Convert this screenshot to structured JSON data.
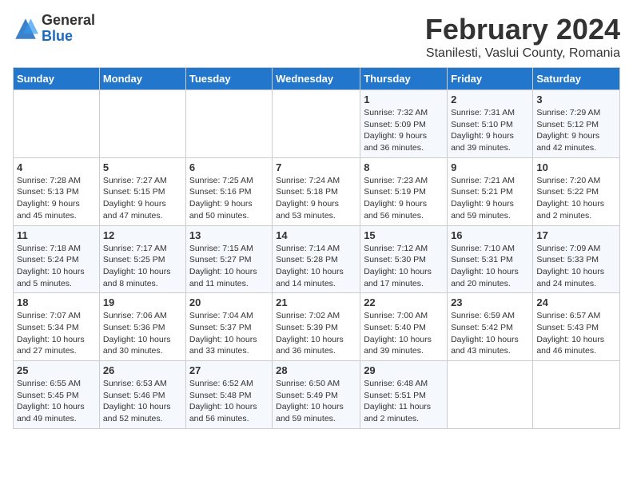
{
  "logo": {
    "general": "General",
    "blue": "Blue"
  },
  "title": {
    "month_year": "February 2024",
    "location": "Stanilesti, Vaslui County, Romania"
  },
  "weekdays": [
    "Sunday",
    "Monday",
    "Tuesday",
    "Wednesday",
    "Thursday",
    "Friday",
    "Saturday"
  ],
  "weeks": [
    [
      {
        "day": "",
        "info": ""
      },
      {
        "day": "",
        "info": ""
      },
      {
        "day": "",
        "info": ""
      },
      {
        "day": "",
        "info": ""
      },
      {
        "day": "1",
        "info": "Sunrise: 7:32 AM\nSunset: 5:09 PM\nDaylight: 9 hours\nand 36 minutes."
      },
      {
        "day": "2",
        "info": "Sunrise: 7:31 AM\nSunset: 5:10 PM\nDaylight: 9 hours\nand 39 minutes."
      },
      {
        "day": "3",
        "info": "Sunrise: 7:29 AM\nSunset: 5:12 PM\nDaylight: 9 hours\nand 42 minutes."
      }
    ],
    [
      {
        "day": "4",
        "info": "Sunrise: 7:28 AM\nSunset: 5:13 PM\nDaylight: 9 hours\nand 45 minutes."
      },
      {
        "day": "5",
        "info": "Sunrise: 7:27 AM\nSunset: 5:15 PM\nDaylight: 9 hours\nand 47 minutes."
      },
      {
        "day": "6",
        "info": "Sunrise: 7:25 AM\nSunset: 5:16 PM\nDaylight: 9 hours\nand 50 minutes."
      },
      {
        "day": "7",
        "info": "Sunrise: 7:24 AM\nSunset: 5:18 PM\nDaylight: 9 hours\nand 53 minutes."
      },
      {
        "day": "8",
        "info": "Sunrise: 7:23 AM\nSunset: 5:19 PM\nDaylight: 9 hours\nand 56 minutes."
      },
      {
        "day": "9",
        "info": "Sunrise: 7:21 AM\nSunset: 5:21 PM\nDaylight: 9 hours\nand 59 minutes."
      },
      {
        "day": "10",
        "info": "Sunrise: 7:20 AM\nSunset: 5:22 PM\nDaylight: 10 hours\nand 2 minutes."
      }
    ],
    [
      {
        "day": "11",
        "info": "Sunrise: 7:18 AM\nSunset: 5:24 PM\nDaylight: 10 hours\nand 5 minutes."
      },
      {
        "day": "12",
        "info": "Sunrise: 7:17 AM\nSunset: 5:25 PM\nDaylight: 10 hours\nand 8 minutes."
      },
      {
        "day": "13",
        "info": "Sunrise: 7:15 AM\nSunset: 5:27 PM\nDaylight: 10 hours\nand 11 minutes."
      },
      {
        "day": "14",
        "info": "Sunrise: 7:14 AM\nSunset: 5:28 PM\nDaylight: 10 hours\nand 14 minutes."
      },
      {
        "day": "15",
        "info": "Sunrise: 7:12 AM\nSunset: 5:30 PM\nDaylight: 10 hours\nand 17 minutes."
      },
      {
        "day": "16",
        "info": "Sunrise: 7:10 AM\nSunset: 5:31 PM\nDaylight: 10 hours\nand 20 minutes."
      },
      {
        "day": "17",
        "info": "Sunrise: 7:09 AM\nSunset: 5:33 PM\nDaylight: 10 hours\nand 24 minutes."
      }
    ],
    [
      {
        "day": "18",
        "info": "Sunrise: 7:07 AM\nSunset: 5:34 PM\nDaylight: 10 hours\nand 27 minutes."
      },
      {
        "day": "19",
        "info": "Sunrise: 7:06 AM\nSunset: 5:36 PM\nDaylight: 10 hours\nand 30 minutes."
      },
      {
        "day": "20",
        "info": "Sunrise: 7:04 AM\nSunset: 5:37 PM\nDaylight: 10 hours\nand 33 minutes."
      },
      {
        "day": "21",
        "info": "Sunrise: 7:02 AM\nSunset: 5:39 PM\nDaylight: 10 hours\nand 36 minutes."
      },
      {
        "day": "22",
        "info": "Sunrise: 7:00 AM\nSunset: 5:40 PM\nDaylight: 10 hours\nand 39 minutes."
      },
      {
        "day": "23",
        "info": "Sunrise: 6:59 AM\nSunset: 5:42 PM\nDaylight: 10 hours\nand 43 minutes."
      },
      {
        "day": "24",
        "info": "Sunrise: 6:57 AM\nSunset: 5:43 PM\nDaylight: 10 hours\nand 46 minutes."
      }
    ],
    [
      {
        "day": "25",
        "info": "Sunrise: 6:55 AM\nSunset: 5:45 PM\nDaylight: 10 hours\nand 49 minutes."
      },
      {
        "day": "26",
        "info": "Sunrise: 6:53 AM\nSunset: 5:46 PM\nDaylight: 10 hours\nand 52 minutes."
      },
      {
        "day": "27",
        "info": "Sunrise: 6:52 AM\nSunset: 5:48 PM\nDaylight: 10 hours\nand 56 minutes."
      },
      {
        "day": "28",
        "info": "Sunrise: 6:50 AM\nSunset: 5:49 PM\nDaylight: 10 hours\nand 59 minutes."
      },
      {
        "day": "29",
        "info": "Sunrise: 6:48 AM\nSunset: 5:51 PM\nDaylight: 11 hours\nand 2 minutes."
      },
      {
        "day": "",
        "info": ""
      },
      {
        "day": "",
        "info": ""
      }
    ]
  ]
}
